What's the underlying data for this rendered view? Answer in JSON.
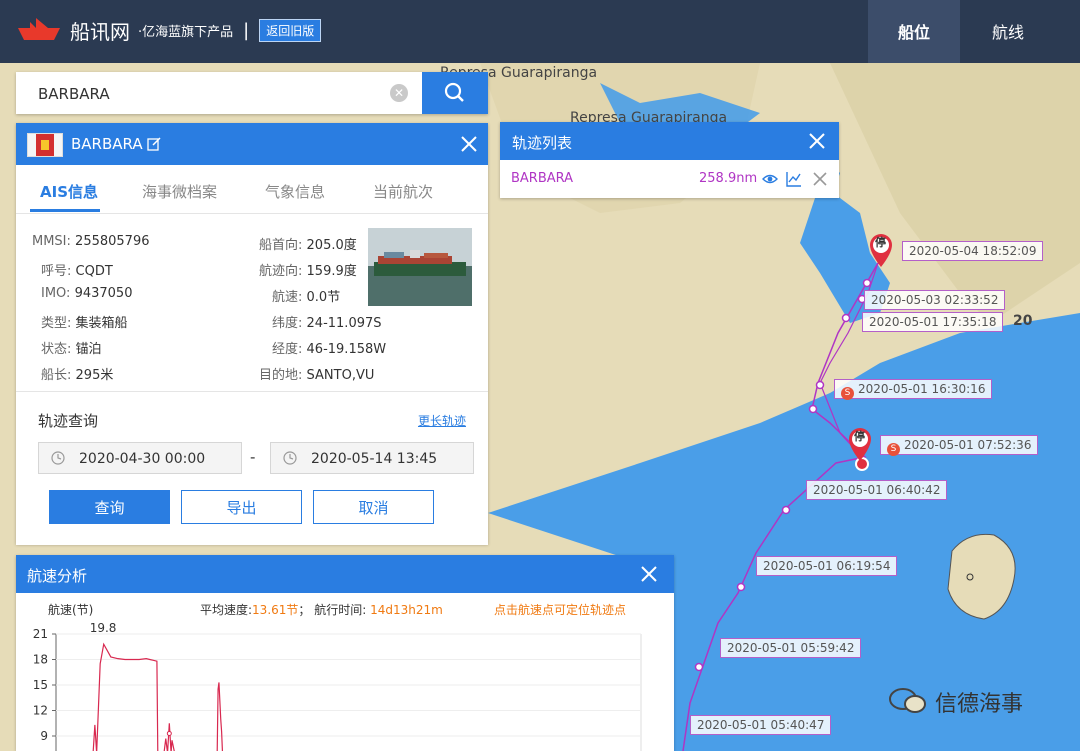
{
  "header": {
    "brand": "船讯网",
    "brand_sub": "·亿海蓝旗下产品",
    "divider": "|",
    "old_version_button": "返回旧版",
    "tabs": [
      {
        "label": "船位",
        "active": true
      },
      {
        "label": "航线",
        "active": false
      }
    ]
  },
  "search": {
    "value": "BARBARA",
    "placeholder": ""
  },
  "ship": {
    "name": "BARBARA",
    "tabs": [
      "AIS信息",
      "海事微档案",
      "气象信息",
      "当前航次"
    ],
    "active_tab": "AIS信息",
    "left_fields": [
      {
        "label": "MMSI:",
        "value": "255805796"
      },
      {
        "label": "呼号:",
        "value": "CQDT"
      },
      {
        "label": "IMO:",
        "value": "9437050"
      },
      {
        "label": "类型:",
        "value": "集装箱船"
      },
      {
        "label": "状态:",
        "value": "锚泊"
      },
      {
        "label": "船长:",
        "value": "295米"
      }
    ],
    "right_fields": [
      {
        "label": "船首向:",
        "value": "205.0度"
      },
      {
        "label": "航迹向:",
        "value": "159.9度"
      },
      {
        "label": "航速:",
        "value": "0.0节"
      },
      {
        "label": "纬度:",
        "value": "24-11.097S"
      },
      {
        "label": "经度:",
        "value": "46-19.158W"
      },
      {
        "label": "目的地:",
        "value": "SANTO,VU"
      }
    ]
  },
  "track_query": {
    "title": "轨迹查询",
    "more_link": "更长轨迹",
    "start": "2020-04-30 00:00",
    "separator": "-",
    "end": "2020-05-14 13:45",
    "buttons": {
      "query": "查询",
      "export": "导出",
      "cancel": "取消"
    }
  },
  "track_list": {
    "title": "轨迹列表",
    "rows": [
      {
        "name": "BARBARA",
        "distance": "258.9nm"
      }
    ]
  },
  "speed": {
    "title": "航速分析",
    "y_label": "航速(节)",
    "avg_label": "平均速度:",
    "avg_value": "13.61节",
    "sep": "；",
    "time_label": "航行时间:",
    "time_value": "14d13h21m",
    "hint": "点击航速点可定位轨迹点",
    "max_label": "19.8"
  },
  "chart_data": {
    "type": "line",
    "title": "",
    "xlabel": "",
    "ylabel": "航速(节)",
    "ylim": [
      7,
      21
    ],
    "yticks": [
      21,
      18,
      15,
      12,
      9
    ],
    "max_annotation": 19.8,
    "series": [
      {
        "color": "#d8284f",
        "x": [
          0,
          2,
          4,
          5,
          6,
          8,
          10,
          14,
          18,
          22,
          26,
          30,
          34,
          36,
          38,
          40,
          40.5,
          41,
          44,
          45,
          46,
          47,
          48,
          48.5,
          50,
          52,
          56,
          62,
          68,
          72,
          74,
          74.5,
          75,
          76,
          76.5,
          77,
          78
        ],
        "y": [
          7,
          7,
          7,
          10.3,
          7,
          17.5,
          19.8,
          18.3,
          18.1,
          18,
          18,
          18,
          18.1,
          18.0,
          17.9,
          17.8,
          7,
          7,
          7,
          8.7,
          7,
          10.5,
          7,
          8.5,
          7,
          7,
          7,
          7,
          7,
          7,
          7,
          14.5,
          15.3,
          11,
          9.5,
          7,
          7
        ]
      }
    ]
  },
  "map": {
    "place_labels": [
      "Represa Guarapiranga",
      "Represa Guarapiranga"
    ],
    "grid_number": "20",
    "stop_marker": "停",
    "stop_badge": "S",
    "track_labels": [
      {
        "text": "2020-05-04 18:52:09",
        "stop": false
      },
      {
        "text": "2020-05-03 02:33:52",
        "stop": false
      },
      {
        "text": "2020-05-01 17:35:18",
        "stop": false
      },
      {
        "text": "2020-05-01 16:30:16",
        "stop": true
      },
      {
        "text": "2020-05-01 07:52:36",
        "stop": true
      },
      {
        "text": "2020-05-01 06:40:42",
        "stop": false
      },
      {
        "text": "2020-05-01 06:19:54",
        "stop": false
      },
      {
        "text": "2020-05-01 05:59:42",
        "stop": false
      },
      {
        "text": "2020-05-01 05:40:47",
        "stop": false
      }
    ]
  },
  "watermark": "信德海事",
  "colors": {
    "header_bg": "#2b3a52",
    "accent": "#2a7de1",
    "track": "#b035c4",
    "orange": "#f07a12",
    "sea": "#4a9ee8",
    "land": "#e6dcb8"
  }
}
